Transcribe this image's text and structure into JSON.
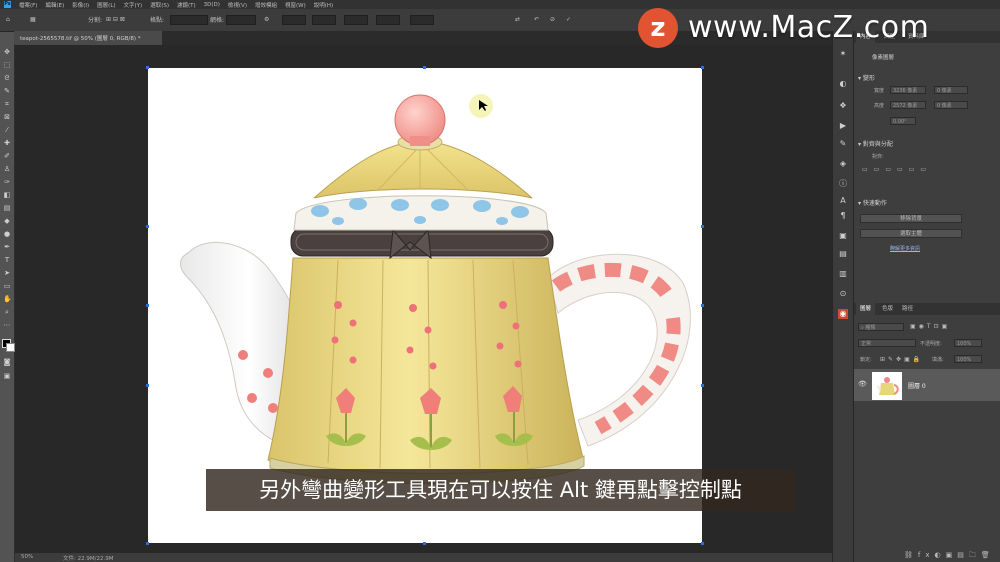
{
  "watermark": {
    "logo_letter": "z",
    "text": "www.MacZ.com"
  },
  "subtitle": "另外彎曲變形工具現在可以按住 Alt 鍵再點擊控制點",
  "menubar": {
    "items": [
      "檔案(F)",
      "編輯(E)",
      "影像(I)",
      "圖層(L)",
      "文字(Y)",
      "選取(S)",
      "濾鏡(T)",
      "3D(D)",
      "檢視(V)",
      "增效模組",
      "視窗(W)",
      "說明(H)"
    ]
  },
  "options": {
    "split_label": "分割:",
    "grid_label": "格點:",
    "mode_label": "網格:"
  },
  "doc_tab": {
    "label": "teapot-2565578.tif @ 50% (圖層 0, RGB/8) *"
  },
  "status": {
    "zoom": "50%",
    "doc_info": "文件: 22.9M/22.9M"
  },
  "panels": {
    "top_tabs": [
      "內容",
      "調整",
      "資料庫"
    ],
    "properties_type": "像素圖層",
    "transform_section": "變形",
    "transform_w_label": "寬度",
    "transform_h_label": "高度",
    "transform_w": "3236 像素",
    "transform_h": "2572 像素",
    "transform_x": "0 像素",
    "transform_y": "0 像素",
    "angle": "0.00°",
    "align_section": "對齊與分配",
    "align_label": "對齊:",
    "quick_section": "快速動作",
    "quick_btn1": "移除背景",
    "quick_btn2": "選取主體",
    "quick_link": "瞭解更多資訊",
    "layer_tabs": [
      "圖層",
      "色版",
      "路徑"
    ],
    "kind_label": "種類",
    "blend_mode": "正常",
    "opacity_label": "不透明度:",
    "opacity": "100%",
    "lock_label": "鎖定:",
    "fill_label": "填滿:",
    "fill": "100%",
    "layer_name": "圖層 0"
  }
}
